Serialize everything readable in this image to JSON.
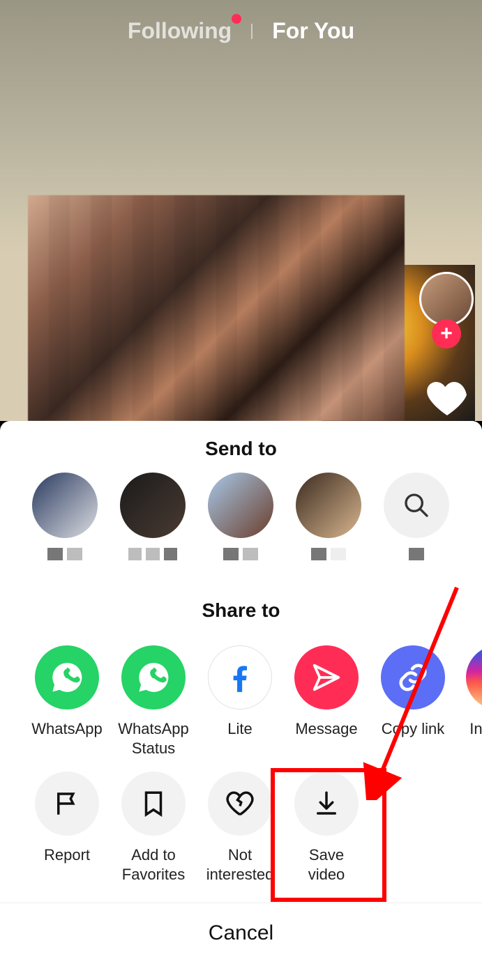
{
  "tabs": {
    "following": "Following",
    "for_you": "For You"
  },
  "follow_plus": "+",
  "sheet": {
    "send_to_title": "Send to",
    "share_to_title": "Share to",
    "cancel": "Cancel"
  },
  "share_apps": [
    {
      "id": "whatsapp",
      "label": "WhatsApp"
    },
    {
      "id": "whatsapp-status",
      "label": "WhatsApp Status"
    },
    {
      "id": "lite",
      "label": "Lite"
    },
    {
      "id": "message",
      "label": "Message"
    },
    {
      "id": "copy-link",
      "label": "Copy link"
    },
    {
      "id": "instagram",
      "label": "Inst"
    }
  ],
  "actions": [
    {
      "id": "report",
      "label": "Report"
    },
    {
      "id": "add-favorites",
      "label": "Add to Favorites"
    },
    {
      "id": "not-interested",
      "label": "Not interested"
    },
    {
      "id": "save-video",
      "label": "Save video"
    }
  ],
  "annotation": {
    "target": "save-video"
  }
}
